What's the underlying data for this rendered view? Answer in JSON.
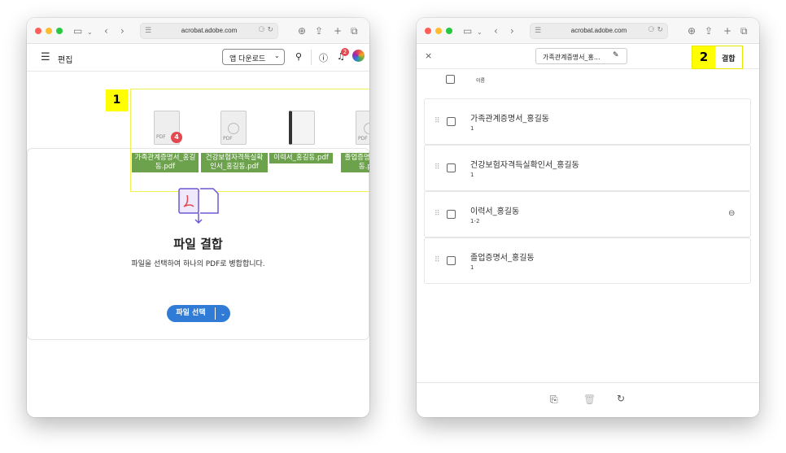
{
  "left": {
    "url": "acrobat.adobe.com",
    "edit_label": "편집",
    "download_btn": "앱 다운로드",
    "notif_count": "2",
    "step": "1",
    "files": [
      {
        "name_line1": "가족관계증명서_홍길",
        "name_line2": "동.pdf",
        "badge": "4",
        "doc_label": "PDF"
      },
      {
        "name_line1": "건강보험자격득실확",
        "name_line2": "인서_홍길동.pdf",
        "doc_label": "PDF"
      },
      {
        "name_line1": "이력서_홍길동.pdf",
        "name_line2": ""
      },
      {
        "name_line1": "졸업증명서_홍길",
        "name_line2": "동.pdf",
        "doc_label": "PDF"
      }
    ],
    "title": "파일 결합",
    "subtitle": "파일을 선택하여 하나의 PDF로 병합합니다.",
    "select_btn": "파일 선택"
  },
  "right": {
    "url": "acrobat.adobe.com",
    "doc_name": "가족관계증명서_홍...",
    "step": "2",
    "combine_btn": "결합",
    "col_header": "이름",
    "rows": [
      {
        "name": "가족관계증명서_홍길동",
        "pages": "1"
      },
      {
        "name": "건강보험자격득실확인서_홍길동",
        "pages": "1"
      },
      {
        "name": "이력서_홍길동",
        "pages": "1-2"
      },
      {
        "name": "졸업증명서_홍길동",
        "pages": "1"
      }
    ]
  },
  "colors": {
    "accent": "#2f7bd6",
    "highlight": "#ffff00",
    "file_label": "#6da24c",
    "notif": "#e34850"
  }
}
